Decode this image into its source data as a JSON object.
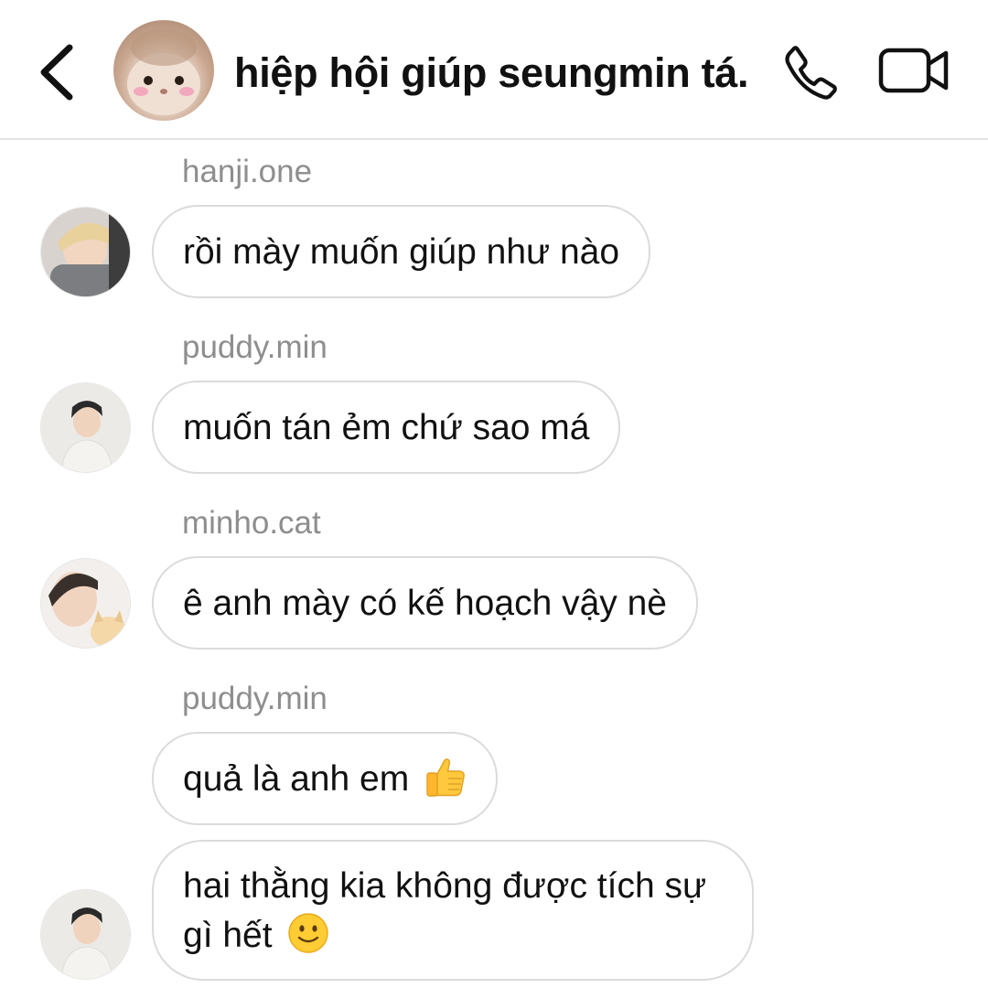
{
  "header": {
    "title": "hiệp hội giúp seungmin tá..",
    "back_icon": "chevron-left-icon",
    "call_icon": "phone-icon",
    "video_icon": "video-camera-icon"
  },
  "messages": [
    {
      "username": "hanji.one",
      "text": "rồi mày muốn giúp như nào"
    },
    {
      "username": "puddy.min",
      "text": "muốn tán ẻm chứ sao má"
    },
    {
      "username": "minho.cat",
      "text": "ê anh mày có kế hoạch vậy nè"
    },
    {
      "username": "puddy.min",
      "text": "quả là anh em",
      "emoji": "thumbs-up-icon"
    },
    {
      "text_line1": "hai thằng kia không được tích sự",
      "text_line2": "gì hết",
      "emoji": "slightly-smiling-face-icon"
    }
  ],
  "colors": {
    "username": "#8e8e8e",
    "bubble_border": "#dbdbdb",
    "divider": "#e3e3e3",
    "text": "#111111"
  }
}
